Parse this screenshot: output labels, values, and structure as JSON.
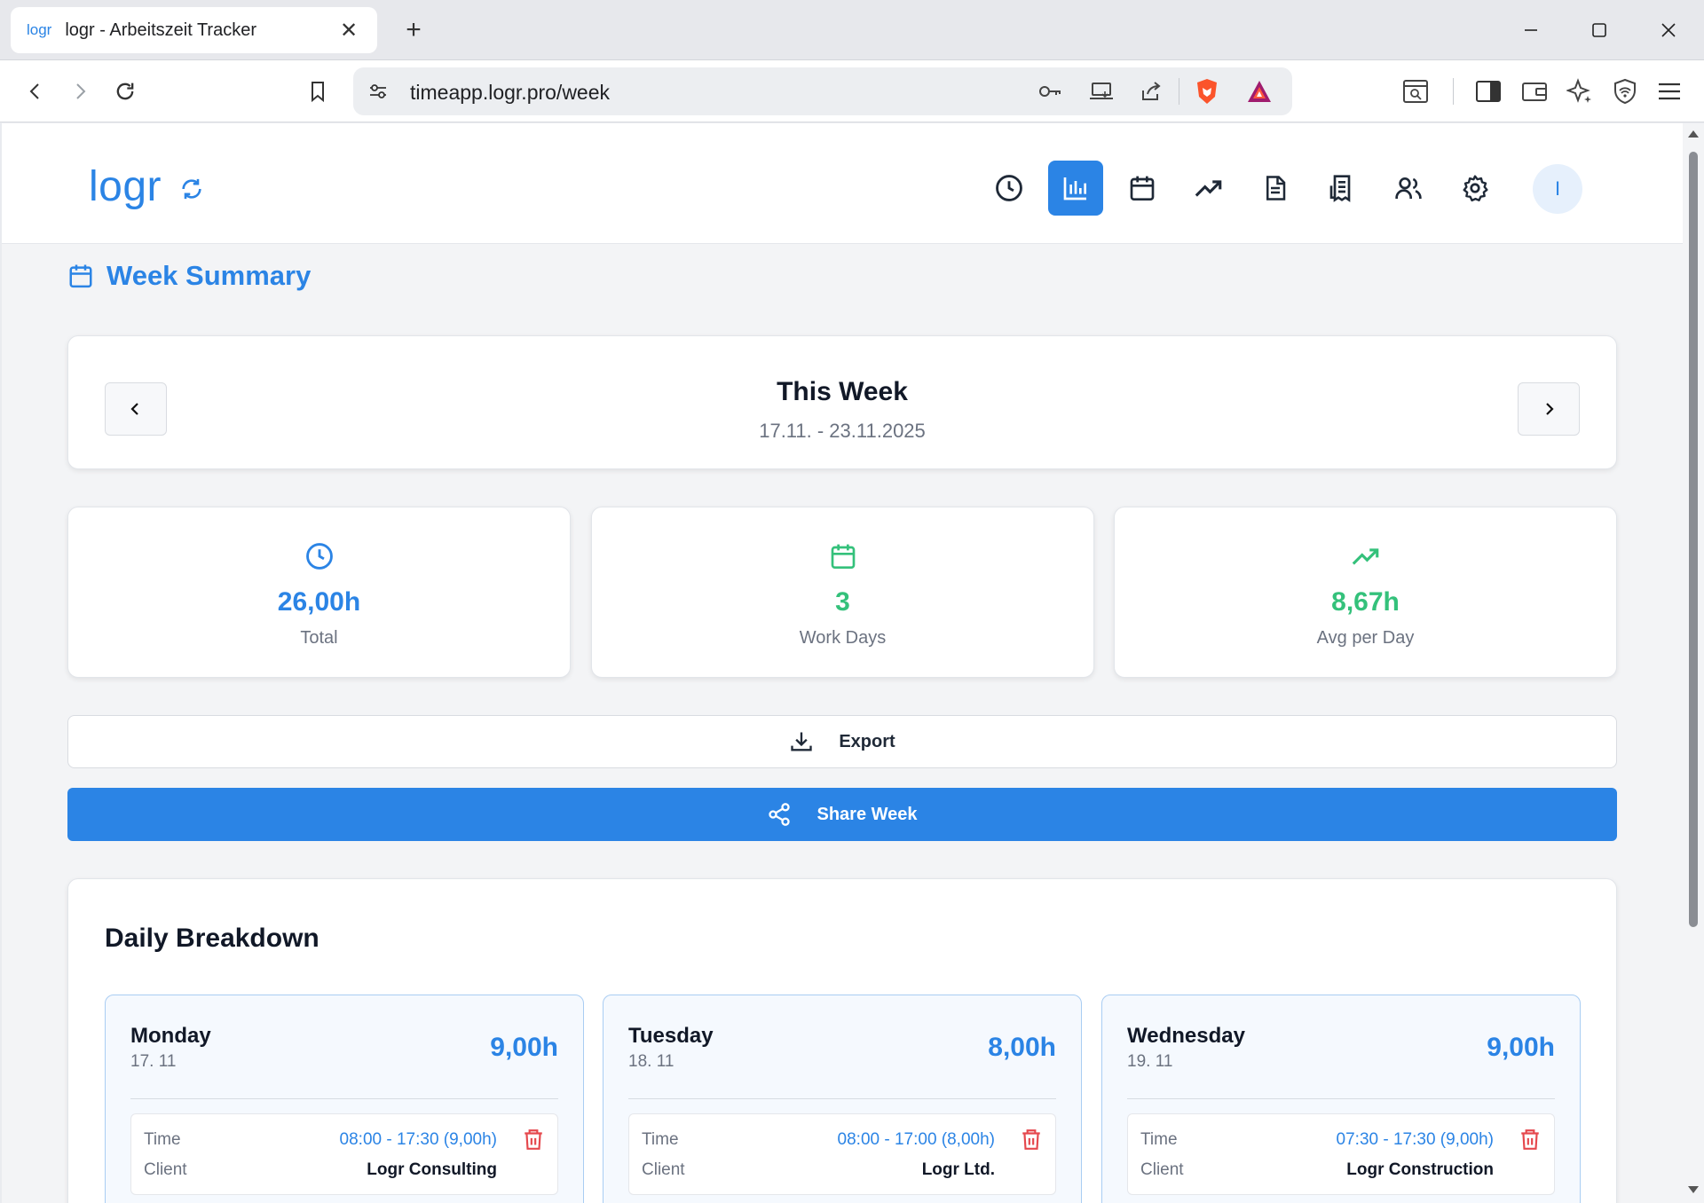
{
  "browser": {
    "tab_favicon_text": "logr",
    "tab_title": "logr - Arbeitszeit Tracker",
    "url": "timeapp.logr.pro/week"
  },
  "app": {
    "logo": "logr",
    "avatar_initial": "I",
    "accent_color": "#2b84e5",
    "success_color": "#34c17b",
    "nav_icons": [
      "clock-icon",
      "bar-chart-icon",
      "calendar-icon",
      "trending-up-icon",
      "document-icon",
      "receipt-icon",
      "users-icon",
      "gear-icon"
    ],
    "active_nav": "bar-chart-icon"
  },
  "page": {
    "title": "Week Summary"
  },
  "week": {
    "title": "This Week",
    "range": "17.11. - 23.11.2025"
  },
  "stats": [
    {
      "value": "26,00h",
      "label": "Total",
      "icon": "clock-icon",
      "color": "#2b84e5"
    },
    {
      "value": "3",
      "label": "Work Days",
      "icon": "calendar-icon",
      "color": "#34c17b"
    },
    {
      "value": "8,67h",
      "label": "Avg per Day",
      "icon": "trending-up-icon",
      "color": "#34c17b"
    }
  ],
  "actions": {
    "export_label": "Export",
    "share_label": "Share Week"
  },
  "daily": {
    "title": "Daily Breakdown",
    "time_label": "Time",
    "client_label": "Client",
    "days": [
      {
        "name": "Monday",
        "date": "17. 11",
        "hours": "9,00h",
        "time": "08:00 - 17:30 (9,00h)",
        "client": "Logr Consulting"
      },
      {
        "name": "Tuesday",
        "date": "18. 11",
        "hours": "8,00h",
        "time": "08:00 - 17:00 (8,00h)",
        "client": "Logr Ltd."
      },
      {
        "name": "Wednesday",
        "date": "19. 11",
        "hours": "9,00h",
        "time": "07:30 - 17:30 (9,00h)",
        "client": "Logr Construction"
      }
    ]
  }
}
